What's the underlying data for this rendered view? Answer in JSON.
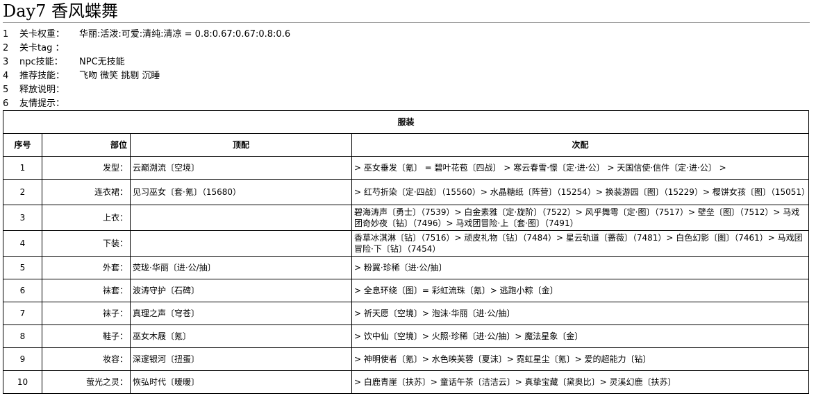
{
  "title": "Day7 香风蝶舞",
  "info": [
    {
      "num": "1",
      "key": "关卡权重：",
      "value": "华丽:活泼:可爱:清纯:清凉 = 0.8:0.67:0.67:0.8:0.6"
    },
    {
      "num": "2",
      "key": "关卡tag ：",
      "value": ""
    },
    {
      "num": "3",
      "key": "npc技能：",
      "value": "NPC无技能"
    },
    {
      "num": "4",
      "key": "推荐技能：",
      "value": "飞吻 微笑 挑剔 沉睡"
    },
    {
      "num": "5",
      "key": "释放说明：",
      "value": ""
    },
    {
      "num": "6",
      "key": "友情提示：",
      "value": ""
    }
  ],
  "table": {
    "caption": "服装",
    "headers": {
      "no": "序号",
      "part": "部位",
      "top": "顶配",
      "sub": "次配"
    },
    "rows": [
      {
        "no": "1",
        "part": "发型：",
        "top": "云巅溯流〔空境〕",
        "sub": "> 巫女垂发〔氪〕 = 碧叶花苞〔四战〕 > 寒云春雪·憬〔定·进·公〕 > 天国信使·信件〔定·进·公〕 >"
      },
      {
        "no": "2",
        "part": "连衣裙：",
        "top": "见习巫女〔套·氪〕（15680）",
        "sub": "> 红芍折染〔定·四战〕（15560）> 水晶糖纸〔阵营〕（15254）> 换装游园〔图〕（15229）> 樱饼女孩〔图〕（15051）"
      },
      {
        "no": "3",
        "part": "上衣：",
        "top": "",
        "sub": "碧海涛声〔勇士〕（7539）> 白金素雅〔定·旋阶〕（7522）> 风乎舞雩〔定·图〕（7517）> 壁垒〔图〕（7512）> 马戏团奇妙夜〔钻〕（7496）> 马戏团冒险·上〔套·图〕（7491）"
      },
      {
        "no": "4",
        "part": "下装：",
        "top": "",
        "sub": "香草冰淇淋〔钻〕（7516）> 顽皮礼物〔钻〕（7484）> 星云轨道〔蔷薇〕（7481）> 白色幻影〔图〕（7461）> 马戏团冒险·下〔钻〕（7454）"
      },
      {
        "no": "5",
        "part": "外套：",
        "top": "荧珑·华丽〔进·公/抽〕",
        "sub": "> 粉翼·珍稀〔进·公/抽〕"
      },
      {
        "no": "6",
        "part": "袜套：",
        "top": "波涛守护〔石碑〕",
        "sub": "> 全息环绕〔图〕= 彩虹流珠〔氪〕> 逃跑小粽〔金〕"
      },
      {
        "no": "7",
        "part": "袜子：",
        "top": "真理之声〔穹苍〕",
        "sub": "> 祈天愿〔空境〕> 泡沫·华丽〔进·公/抽〕"
      },
      {
        "no": "8",
        "part": "鞋子：",
        "top": "巫女木屐〔氪〕",
        "sub": "> 饮中仙〔空境〕> 火照·珍稀〔进·公/抽〕> 魔法星象〔金〕"
      },
      {
        "no": "9",
        "part": "妆容：",
        "top": "深邃银河〔扭蛋〕",
        "sub": "> 神明使者〔氪〕> 水色映芙蓉〔夏沫〕> 霓虹星尘〔氪〕> 爱的超能力〔钻〕"
      },
      {
        "no": "10",
        "part": "萤光之灵：",
        "top": "恢弘时代〔暖暖〕",
        "sub": "> 白鹿青崖〔扶苏〕> 童话午茶〔洁洁云〕> 真挚宝藏〔黛奥比〕> 灵溪幻鹿〔扶苏〕"
      }
    ]
  }
}
